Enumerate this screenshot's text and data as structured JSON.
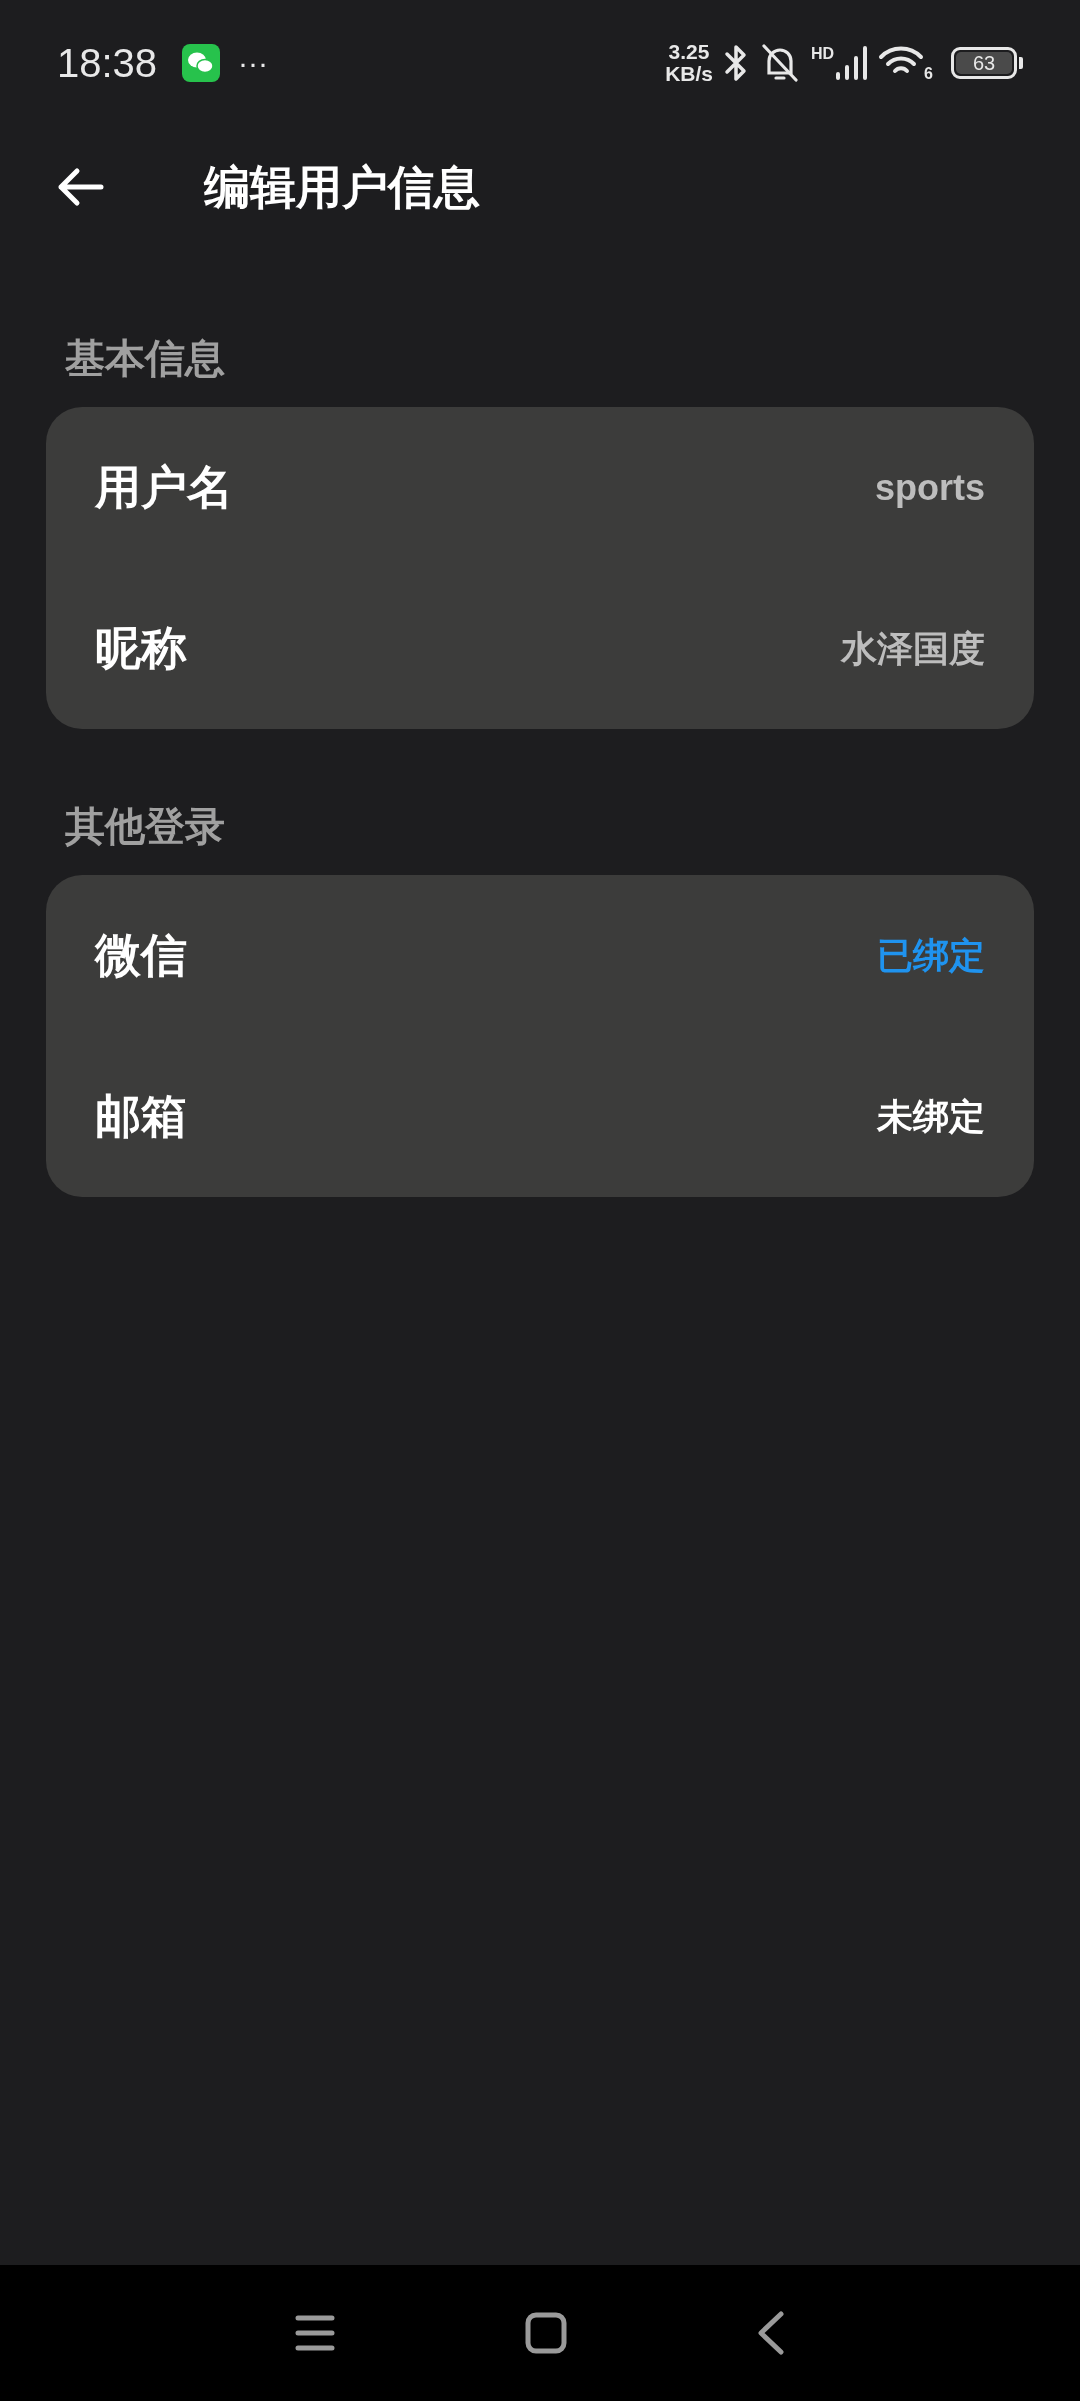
{
  "status_bar": {
    "time": "18:38",
    "more": "···",
    "speed_value": "3.25",
    "speed_unit": "KB/s",
    "network_label": "HD",
    "wifi_label": "6",
    "battery": "63"
  },
  "header": {
    "title": "编辑用户信息"
  },
  "sections": [
    {
      "title": "基本信息",
      "items": [
        {
          "label": "用户名",
          "value": "sports"
        },
        {
          "label": "昵称",
          "value": "水泽国度"
        }
      ]
    },
    {
      "title": "其他登录",
      "items": [
        {
          "label": "微信",
          "value": "已绑定",
          "bound": true
        },
        {
          "label": "邮箱",
          "value": "未绑定",
          "bound": false
        }
      ]
    }
  ]
}
